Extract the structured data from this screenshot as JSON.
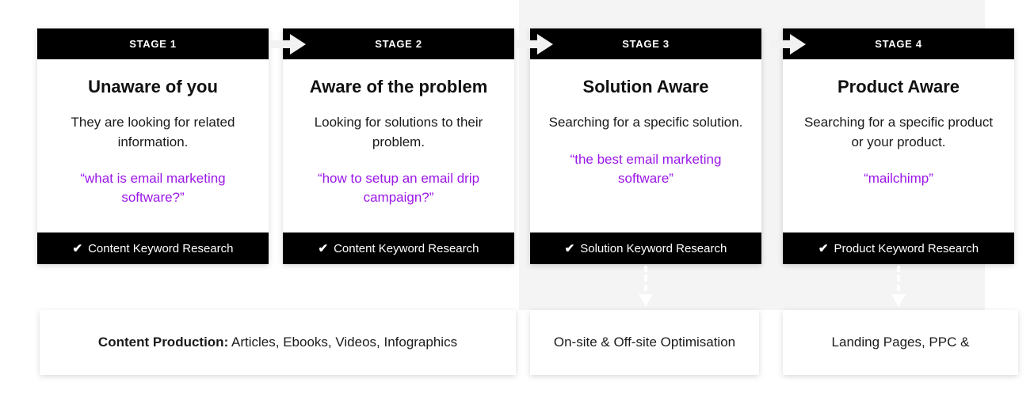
{
  "theme": {
    "page_background": "#ffffff",
    "band_background": "#f4f4f4",
    "header_background": "#000000",
    "footer_background": "#000000",
    "accent_query_color": "#9b16e8",
    "body_text_color": "#1a1a1a"
  },
  "stages": [
    {
      "badge": "STAGE 1",
      "title": "Unaware of you",
      "description": "They are looking for related information.",
      "query": "“what is email marketing software?”",
      "footer": "Content Keyword Research",
      "check_icon": "✔",
      "has_arrow": false
    },
    {
      "badge": "STAGE 2",
      "title": "Aware of the problem",
      "description": "Looking for solutions to their problem.",
      "query": "“how to setup an email drip campaign?”",
      "footer": "Content Keyword Research",
      "check_icon": "✔",
      "has_arrow": true
    },
    {
      "badge": "STAGE 3",
      "title": "Solution Aware",
      "description": "Searching for a specific solution.",
      "query": "“the best email marketing software”",
      "footer": "Solution Keyword Research",
      "check_icon": "✔",
      "has_arrow": true
    },
    {
      "badge": "STAGE 4",
      "title": "Product Aware",
      "description": "Searching for a specific product or your product.",
      "query": "“mailchimp”",
      "footer": "Product Keyword Research",
      "check_icon": "✔",
      "has_arrow": true
    }
  ],
  "outputs": [
    {
      "label": "Content Production:",
      "text": " Articles, Ebooks, Videos, Infographics"
    },
    {
      "label": "",
      "text": "On-site & Off-site Optimisation"
    },
    {
      "label": "",
      "text": "Landing Pages, PPC &"
    }
  ],
  "icons": {
    "stage_arrow": "right-arrow-icon",
    "down_connector": "down-arrow-connector-icon",
    "check": "check-icon"
  }
}
